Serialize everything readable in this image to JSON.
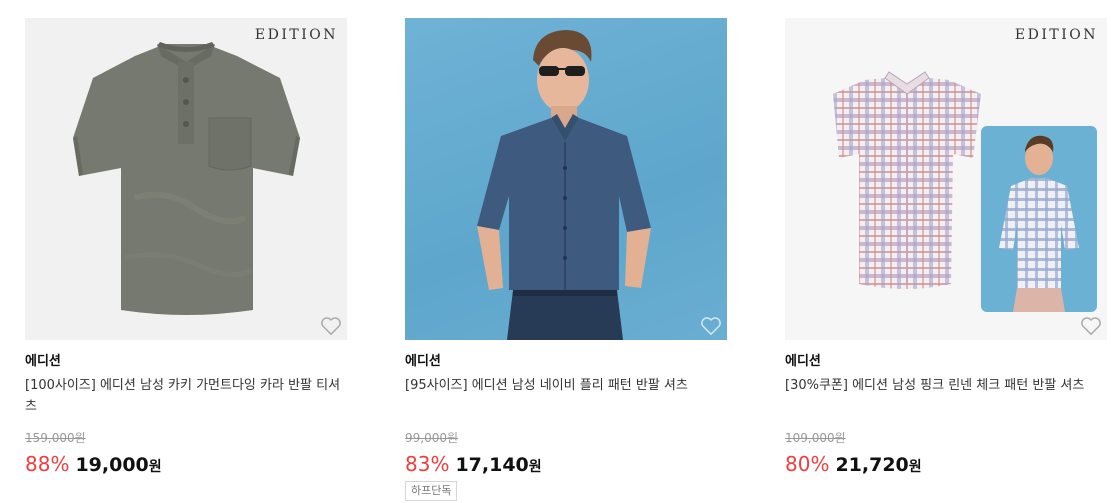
{
  "products": [
    {
      "logo": "EDITION",
      "brand": "에디션",
      "title": "[100사이즈] 에디션 남성 카키 가먼트다잉 카라 반팔 티셔츠",
      "original_price": "159,000원",
      "discount": "88%",
      "price": "19,000",
      "currency": "원",
      "badge": "",
      "image": "khaki-polo-shirt"
    },
    {
      "logo": "",
      "brand": "에디션",
      "title": "[95사이즈] 에디션 남성 네이비 플리 패턴 반팔 셔츠",
      "original_price": "99,000원",
      "discount": "83%",
      "price": "17,140",
      "currency": "원",
      "badge": "하프단독",
      "image": "navy-shirt-model"
    },
    {
      "logo": "EDITION",
      "brand": "에디션",
      "title": "[30%쿠폰] 에디션 남성 핑크 린넨 체크 패턴 반팔 셔츠",
      "original_price": "109,000원",
      "discount": "80%",
      "price": "21,720",
      "currency": "원",
      "badge": "",
      "image": "pink-check-shirt"
    }
  ],
  "colors": {
    "discount": "#ee3e3e",
    "strike": "#999999"
  }
}
